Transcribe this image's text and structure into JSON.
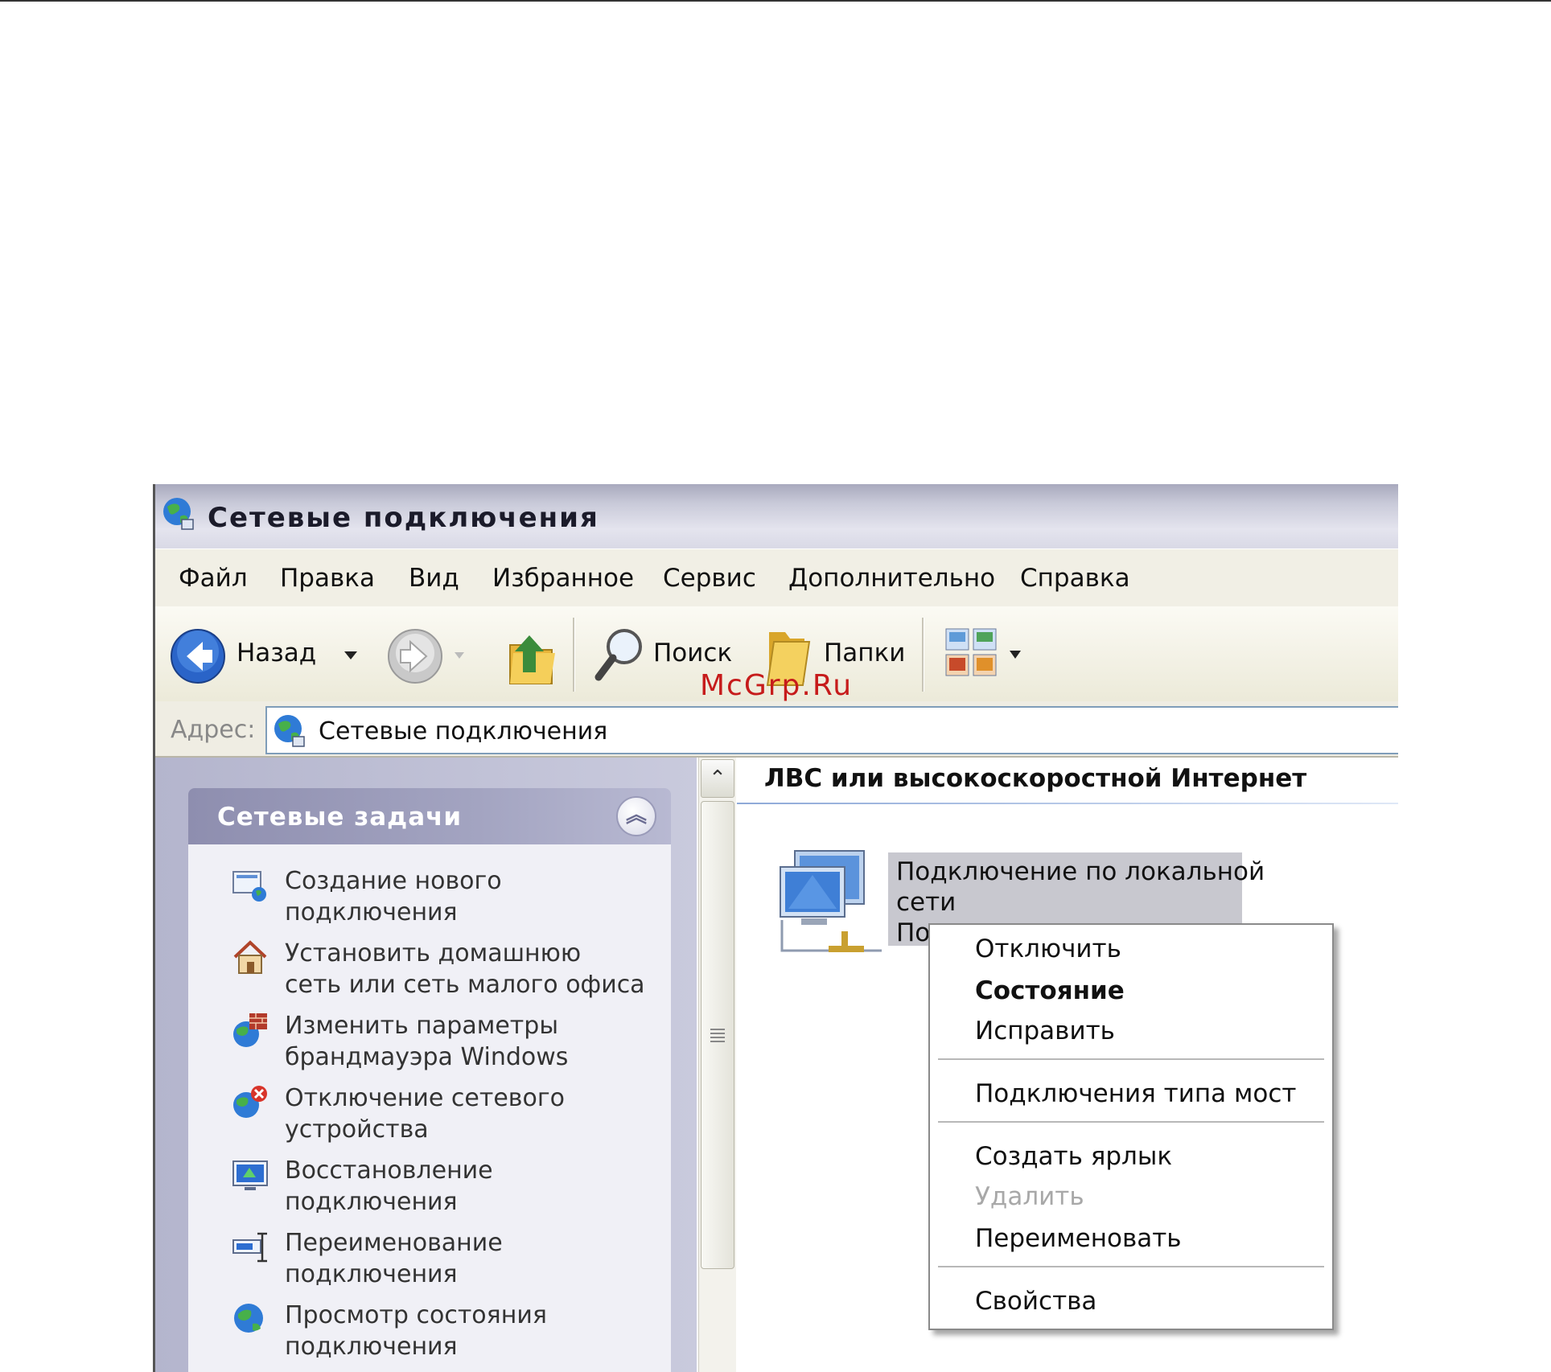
{
  "window": {
    "title": "Сетевые подключения",
    "title_icon": "network-connections-icon"
  },
  "menu": {
    "items": [
      "Файл",
      "Правка",
      "Вид",
      "Избранное",
      "Сервис",
      "Дополнительно",
      "Справка"
    ]
  },
  "toolbar": {
    "back_label": "Назад",
    "search_label": "Поиск",
    "folders_label": "Папки",
    "icons": [
      "back-arrow-icon",
      "dropdown-icon",
      "forward-arrow-icon",
      "up-folder-icon",
      "search-icon",
      "folders-icon",
      "views-icon"
    ]
  },
  "address": {
    "label": "Адрес:",
    "value": "Сетевые подключения"
  },
  "tasks": {
    "header": "Сетевые задачи",
    "items": [
      {
        "line1": "Создание нового",
        "line2": "подключения",
        "icon": "new-connection-icon"
      },
      {
        "line1": "Установить домашнюю",
        "line2": "сеть или сеть малого офиса",
        "icon": "home-network-icon"
      },
      {
        "line1": "Изменить параметры",
        "line2": "брандмауэра Windows",
        "icon": "firewall-icon"
      },
      {
        "line1": "Отключение сетевого",
        "line2": "устройства",
        "icon": "disable-device-icon"
      },
      {
        "line1": "Восстановление",
        "line2": "подключения",
        "icon": "repair-connection-icon"
      },
      {
        "line1": "Переименование",
        "line2": "подключения",
        "icon": "rename-icon"
      },
      {
        "line1": "Просмотр состояния",
        "line2": "подключения",
        "icon": "status-icon"
      }
    ]
  },
  "content": {
    "group_header": "ЛВС или высокоскоростной Интернет",
    "connection": {
      "line1": "Подключение по локальной",
      "line2": "сети",
      "line3_partial": "По"
    }
  },
  "context_menu": {
    "disconnect": "Отключить",
    "status": "Состояние",
    "repair": "Исправить",
    "bridge": "Подключения типа мост",
    "shortcut": "Создать ярлык",
    "delete": "Удалить",
    "rename": "Переименовать",
    "properties": "Свойства"
  },
  "watermark": "McGrp.Ru",
  "colors": {
    "menu_bg": "#f1efe5",
    "task_pane": "#b4b5cd",
    "selection": "#c8c8cf",
    "watermark": "#c61b1b"
  }
}
